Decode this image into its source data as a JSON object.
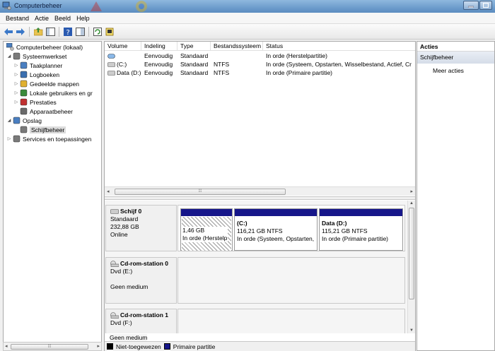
{
  "window": {
    "title": "Computerbeheer"
  },
  "menu": [
    "Bestand",
    "Actie",
    "Beeld",
    "Help"
  ],
  "toolbar": [
    "back-arrow-icon",
    "forward-arrow-icon",
    "folder-up-icon",
    "show-hide-tree-icon",
    "help-icon",
    "properties-icon",
    "refresh-icon",
    "export-icon"
  ],
  "tree": {
    "root": "Computerbeheer (lokaal)",
    "items": [
      {
        "label": "Systeemwerkset",
        "level": 1,
        "exp": "◢",
        "icon": "tools-icon"
      },
      {
        "label": "Taakplanner",
        "level": 2,
        "exp": "▷",
        "icon": "clock-icon"
      },
      {
        "label": "Logboeken",
        "level": 2,
        "exp": "▷",
        "icon": "event-viewer-icon"
      },
      {
        "label": "Gedeelde mappen",
        "level": 2,
        "exp": "▷",
        "icon": "shared-folder-icon"
      },
      {
        "label": "Lokale gebruikers en gr",
        "level": 2,
        "exp": "▷",
        "icon": "users-icon"
      },
      {
        "label": "Prestaties",
        "level": 2,
        "exp": "▷",
        "icon": "no-entry-icon"
      },
      {
        "label": "Apparaatbeheer",
        "level": 2,
        "exp": "",
        "icon": "device-manager-icon"
      },
      {
        "label": "Opslag",
        "level": 1,
        "exp": "◢",
        "icon": "storage-icon"
      },
      {
        "label": "Schijfbeheer",
        "level": 2,
        "exp": "",
        "icon": "disk-management-icon",
        "selected": true
      },
      {
        "label": "Services en toepassingen",
        "level": 1,
        "exp": "▷",
        "icon": "services-icon"
      }
    ]
  },
  "volumes": {
    "columns": [
      "Volume",
      "Indeling",
      "Type",
      "Bestandssysteem",
      "Status"
    ],
    "rows": [
      [
        "",
        "Eenvoudig",
        "Standaard",
        "",
        "In orde (Herstelpartitie)"
      ],
      [
        "(C:)",
        "Eenvoudig",
        "Standaard",
        "NTFS",
        "In orde (Systeem, Opstarten, Wisselbestand, Actief, Cr"
      ],
      [
        "Data (D:)",
        "Eenvoudig",
        "Standaard",
        "NTFS",
        "In orde (Primaire partitie)"
      ]
    ]
  },
  "disks": [
    {
      "name": "Schijf 0",
      "type": "Standaard",
      "size": "232,88 GB",
      "state": "Online",
      "partitions": [
        {
          "name": "",
          "size": "1,46 GB",
          "status": "In orde (Herstelp"
        },
        {
          "name": "(C:)",
          "size": "116,21 GB NTFS",
          "status": "In orde (Systeem, Opstarten,"
        },
        {
          "name": "Data  (D:)",
          "size": "115,21 GB NTFS",
          "status": "In orde (Primaire partitie)"
        }
      ]
    },
    {
      "name": "Cd-rom-station 0",
      "drive": "Dvd (E:)",
      "state": "Geen medium"
    },
    {
      "name": "Cd-rom-station 1",
      "drive": "Dvd (F:)",
      "state": "Geen medium"
    }
  ],
  "legend": [
    {
      "label": "Niet-toegewezen",
      "color": "#000000"
    },
    {
      "label": "Primaire partitie",
      "color": "#16168a"
    }
  ],
  "actions": {
    "header": "Acties",
    "section": "Schijfbeheer",
    "more": "Meer acties"
  },
  "colors": {
    "partition_bar": "#16168a",
    "title_bar": "#6d9ccc"
  }
}
